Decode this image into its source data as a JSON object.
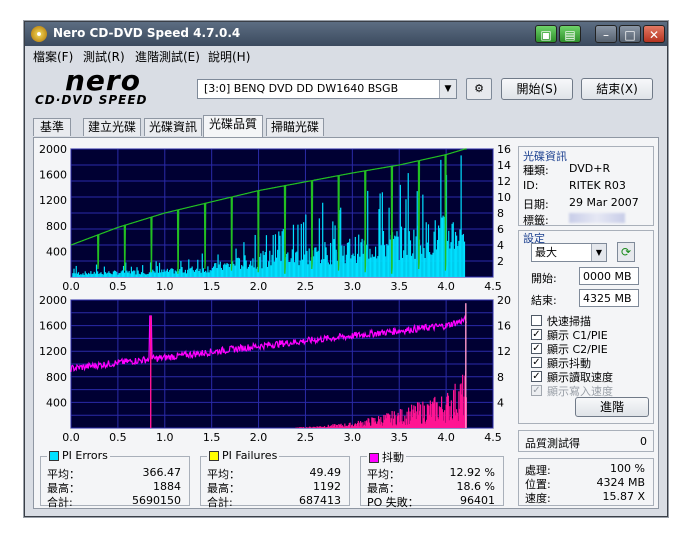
{
  "window": {
    "title": "Nero CD-DVD Speed 4.7.0.4"
  },
  "menu": [
    "檔案(F)",
    "測試(R)",
    "進階測試(E)",
    "說明(H)"
  ],
  "logo": {
    "name": "nero",
    "tagline": "CD·DVD SPEED"
  },
  "toolbar": {
    "drive": "[3:0]   BENQ DVD DD DW1640 BSGB",
    "start_label": "開始(S)",
    "end_label": "結束(X)"
  },
  "tabs": [
    "基準",
    "建立光碟",
    "光碟資訊",
    "光碟品質",
    "掃瞄光碟"
  ],
  "active_tab": 3,
  "disc_info": {
    "header": "光碟資訊",
    "type_label": "種類:",
    "type_value": "DVD+R",
    "id_label": "ID:",
    "id_value": "RITEK R03",
    "date_label": "日期:",
    "date_value": "29 Mar 2007",
    "tag_label": "標籤:",
    "tag_value": ""
  },
  "settings": {
    "header": "設定",
    "speed_value": "最大",
    "start_label": "開始:",
    "start_value": "0000 MB",
    "end_label": "結束:",
    "end_value": "4325 MB",
    "checkboxes": [
      {
        "label": "快速掃描",
        "checked": false,
        "enabled": true
      },
      {
        "label": "顯示 C1/PIE",
        "checked": true,
        "enabled": true
      },
      {
        "label": "顯示 C2/PIE",
        "checked": true,
        "enabled": true
      },
      {
        "label": "顯示抖動",
        "checked": true,
        "enabled": true
      },
      {
        "label": "顯示讀取速度",
        "checked": true,
        "enabled": true
      },
      {
        "label": "顯示寫入速度",
        "checked": true,
        "enabled": false
      }
    ],
    "advanced_label": "進階"
  },
  "quality": {
    "label": "品質測試得",
    "value": "0"
  },
  "progress": {
    "process_label": "處理:",
    "process_value": "100 %",
    "position_label": "位置:",
    "position_value": "4324 MB",
    "speed_label": "速度:",
    "speed_value": "15.87 X"
  },
  "pi_errors": {
    "title": "PI Errors",
    "color": "#00e0ff",
    "avg_label": "平均：",
    "avg": "366.47",
    "max_label": "最高：",
    "max": "1884",
    "total_label": "合計:",
    "total": "5690150"
  },
  "pi_failures": {
    "title": "PI Failures",
    "color": "#ffff00",
    "avg_label": "平均：",
    "avg": "49.49",
    "max_label": "最高：",
    "max": "1192",
    "total_label": "合計:",
    "total": "687413"
  },
  "jitter": {
    "title": "抖動",
    "color": "#ff00ff",
    "avg_label": "平均：",
    "avg": "12.92 %",
    "max_label": "最高：",
    "max": "18.6 %",
    "po_label": "PO 失敗：",
    "po": "96401"
  },
  "chart_data": [
    {
      "type": "area",
      "title": "",
      "y_left_ticks": [
        "2000",
        "1600",
        "1200",
        "800",
        "400"
      ],
      "y_right_ticks": [
        "16",
        "14",
        "12",
        "10",
        "8",
        "6",
        "4",
        "2"
      ],
      "x_ticks": [
        "0.0",
        "0.5",
        "1.0",
        "1.5",
        "2.0",
        "2.5",
        "3.0",
        "3.5",
        "4.0",
        "4.5"
      ],
      "xlim": [
        0,
        4.5
      ],
      "ylim_left": [
        0,
        2000
      ],
      "ylim_right": [
        0,
        16
      ],
      "series": [
        {
          "name": "PI Errors",
          "axis": "left",
          "color": "#00e0ff",
          "x": [
            0.0,
            0.5,
            1.0,
            1.5,
            2.0,
            2.5,
            3.0,
            3.5,
            3.8,
            4.0,
            4.2
          ],
          "y": [
            80,
            100,
            120,
            200,
            380,
            480,
            620,
            750,
            850,
            950,
            1050
          ]
        },
        {
          "name": "讀取速度",
          "axis": "right",
          "color": "#22c022",
          "x": [
            0.0,
            0.5,
            1.0,
            1.5,
            2.0,
            2.5,
            3.0,
            3.5,
            4.0,
            4.2
          ],
          "y": [
            4.0,
            6.2,
            8.0,
            9.4,
            10.8,
            11.9,
            13.0,
            14.0,
            15.3,
            16.0
          ]
        }
      ]
    },
    {
      "type": "area",
      "title": "",
      "y_left_ticks": [
        "2000",
        "1600",
        "1200",
        "800",
        "400"
      ],
      "y_right_ticks": [
        "20",
        "16",
        "12",
        "8",
        "4"
      ],
      "x_ticks": [
        "0.0",
        "0.5",
        "1.0",
        "1.5",
        "2.0",
        "2.5",
        "3.0",
        "3.5",
        "4.0",
        "4.5"
      ],
      "xlim": [
        0,
        4.5
      ],
      "ylim_left": [
        0,
        2000
      ],
      "ylim_right": [
        0,
        20
      ],
      "series": [
        {
          "name": "抖動",
          "axis": "right",
          "color": "#ff00ff",
          "x": [
            0.0,
            0.5,
            1.0,
            1.5,
            2.0,
            2.5,
            3.0,
            3.5,
            4.0,
            4.2
          ],
          "y": [
            9.3,
            10.2,
            11.0,
            11.9,
            12.8,
            13.6,
            14.4,
            15.2,
            16.0,
            16.9
          ]
        },
        {
          "name": "PI Failures",
          "axis": "left",
          "color": "#ff1493",
          "x": [
            0.0,
            2.5,
            3.0,
            3.5,
            4.0,
            4.2
          ],
          "y": [
            0,
            10,
            60,
            200,
            380,
            600
          ]
        }
      ]
    }
  ]
}
